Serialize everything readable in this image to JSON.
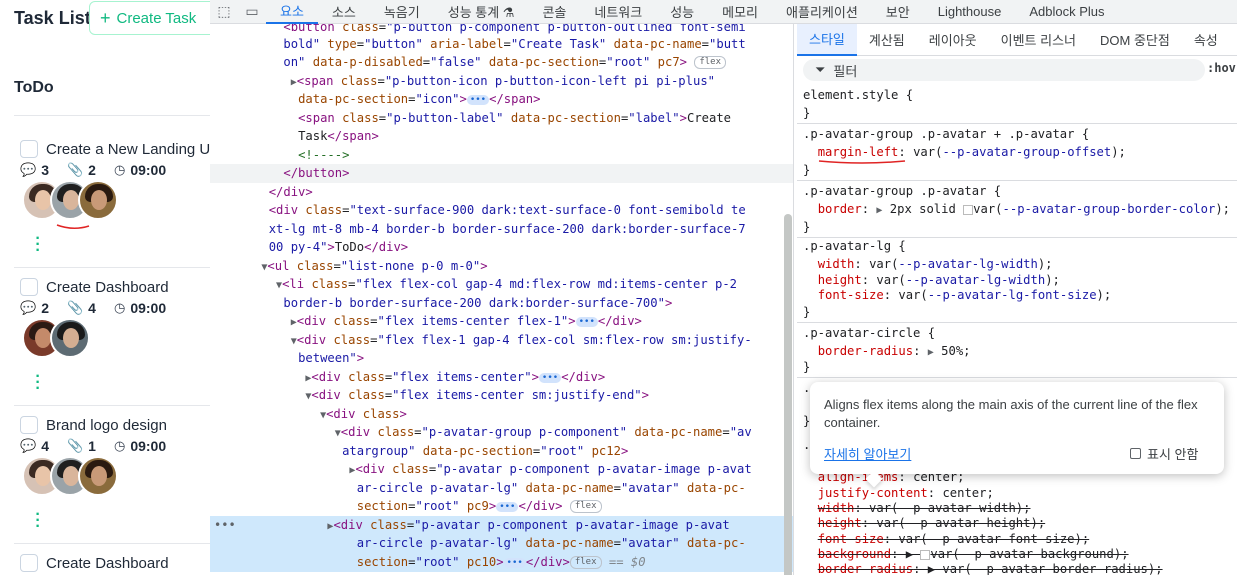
{
  "app": {
    "title": "Task List",
    "create_button": "Create Task",
    "section": "ToDo",
    "tasks": [
      {
        "name": "Create a New Landing U",
        "comments": "3",
        "attachments": "2",
        "time": "09:00"
      },
      {
        "name": "Create Dashboard",
        "comments": "2",
        "attachments": "4",
        "time": "09:00"
      },
      {
        "name": "Brand logo design",
        "comments": "4",
        "attachments": "1",
        "time": "09:00"
      },
      {
        "name": "Create Dashboard"
      }
    ]
  },
  "devtools": {
    "tabs": [
      "요소",
      "소스",
      "녹음기",
      "성능 통계 ⚗",
      "콘솔",
      "네트워크",
      "성능",
      "메모리",
      "애플리케이션",
      "보안",
      "Lighthouse",
      "Adblock Plus"
    ],
    "styles_tabs": [
      "스타일",
      "계산됨",
      "레이아웃",
      "이벤트 리스너",
      "DOM 중단점",
      "속성"
    ],
    "filter_placeholder": "필터",
    "hov": ":hov",
    "tooltip": {
      "text": "Aligns flex items along the main axis of the current line of the flex container.",
      "link": "자세히 알아보기",
      "dont_show": "표시 안함"
    },
    "colors": {
      "accent": "#1a73e8",
      "tag": "#881280",
      "attr": "#994500",
      "value": "#1a1aa6",
      "selected_row": "#cfe8fc",
      "brand_green": "#10b981"
    }
  }
}
